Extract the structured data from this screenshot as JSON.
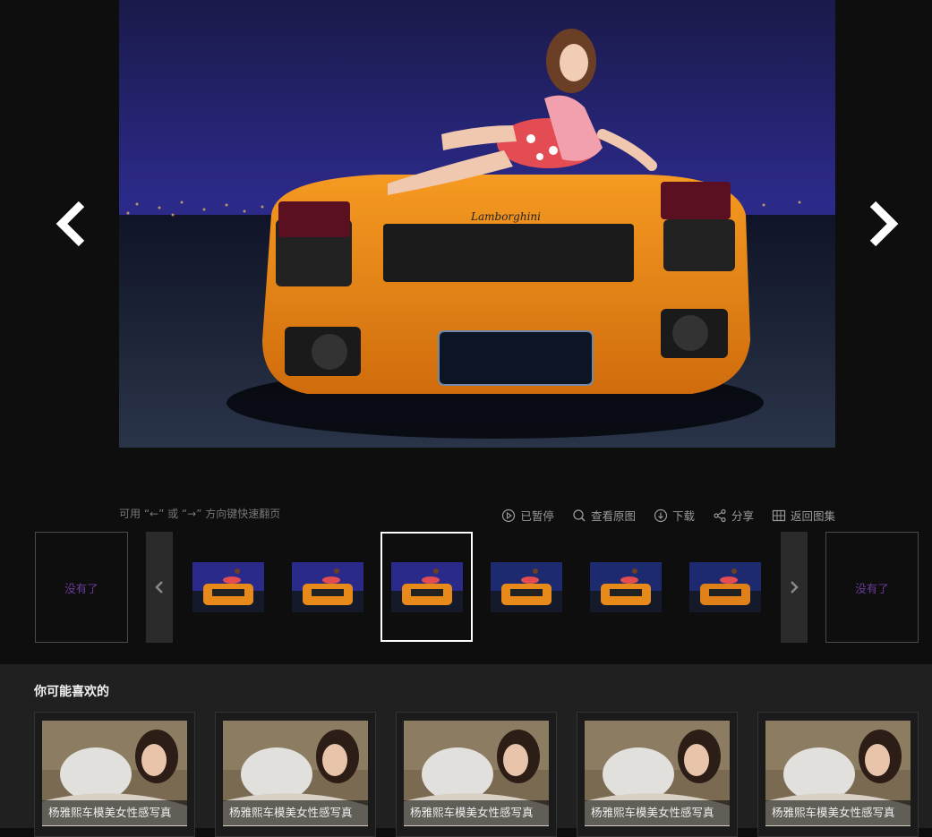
{
  "main_image": {
    "plate_brand": "Lamborghini"
  },
  "hint": "可用 “←” 或 “→” 方向键快速翻页",
  "toolbar": {
    "pause": "已暂停",
    "view_original": "查看原图",
    "download": "下载",
    "share": "分享",
    "back_to_album": "返回图集"
  },
  "strip": {
    "prev_end_label": "没有了",
    "next_end_label": "没有了",
    "thumbnails": [
      {
        "car_color": "#e88a1a",
        "sky": "#2a2a8a"
      },
      {
        "car_color": "#e88a1a",
        "sky": "#2a2a8a"
      },
      {
        "car_color": "#e88a1a",
        "sky": "#2a2a8a"
      },
      {
        "car_color": "#e88a1a",
        "sky": "#1e2a70"
      },
      {
        "car_color": "#e88a1a",
        "sky": "#1e2a70"
      },
      {
        "car_color": "#e08018",
        "sky": "#1e2a70"
      }
    ],
    "active_index": 2
  },
  "related": {
    "title": "你可能喜欢的",
    "items": [
      {
        "caption": "杨雅熙车模美女性感写真"
      },
      {
        "caption": "杨雅熙车模美女性感写真"
      },
      {
        "caption": "杨雅熙车模美女性感写真"
      },
      {
        "caption": "杨雅熙车模美女性感写真"
      },
      {
        "caption": "杨雅熙车模美女性感写真"
      }
    ]
  },
  "colors": {
    "background": "#0e0e0e",
    "panel": "#202020",
    "end_label": "#6a3b9a",
    "car_orange": "#e88a1a"
  }
}
